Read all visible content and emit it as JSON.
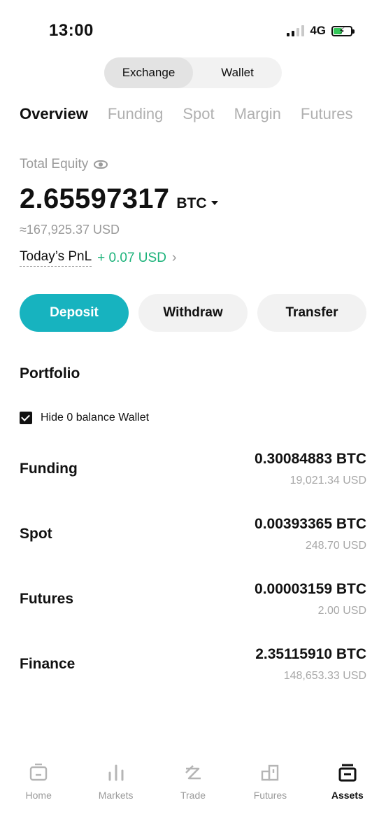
{
  "status_bar": {
    "time": "13:00",
    "network": "4G",
    "icons": [
      "signal-icon",
      "battery-charging-icon"
    ]
  },
  "segmented": {
    "items": [
      {
        "label": "Exchange",
        "active": true
      },
      {
        "label": "Wallet",
        "active": false
      }
    ]
  },
  "tabs": {
    "items": [
      {
        "label": "Overview",
        "active": true
      },
      {
        "label": "Funding",
        "active": false
      },
      {
        "label": "Spot",
        "active": false
      },
      {
        "label": "Margin",
        "active": false
      },
      {
        "label": "Futures",
        "active": false
      }
    ]
  },
  "equity": {
    "label": "Total Equity",
    "value": "2.65597317",
    "unit": "BTC",
    "usd": "≈167,925.37 USD",
    "pnl_label": "Today’s PnL",
    "pnl_value": "+ 0.07 USD"
  },
  "actions": {
    "deposit": "Deposit",
    "withdraw": "Withdraw",
    "transfer": "Transfer"
  },
  "portfolio": {
    "title": "Portfolio",
    "hide_zero_label": "Hide 0 balance Wallet",
    "wallets": [
      {
        "name": "Funding",
        "btc": "0.30084883 BTC",
        "usd": "19,021.34 USD"
      },
      {
        "name": "Spot",
        "btc": "0.00393365 BTC",
        "usd": "248.70 USD"
      },
      {
        "name": "Futures",
        "btc": "0.00003159 BTC",
        "usd": "2.00 USD"
      },
      {
        "name": "Finance",
        "btc": "2.35115910 BTC",
        "usd": "148,653.33 USD"
      }
    ]
  },
  "bottom_nav": {
    "items": [
      {
        "label": "Home",
        "icon": "home-icon",
        "active": false
      },
      {
        "label": "Markets",
        "icon": "bar-chart-icon",
        "active": false
      },
      {
        "label": "Trade",
        "icon": "trade-icon",
        "active": false
      },
      {
        "label": "Futures",
        "icon": "futures-icon",
        "active": false
      },
      {
        "label": "Assets",
        "icon": "wallet-icon",
        "active": true
      }
    ]
  },
  "colors": {
    "accent": "#17b3bf",
    "positive": "#1bb27a",
    "muted": "#9a9a9a"
  }
}
